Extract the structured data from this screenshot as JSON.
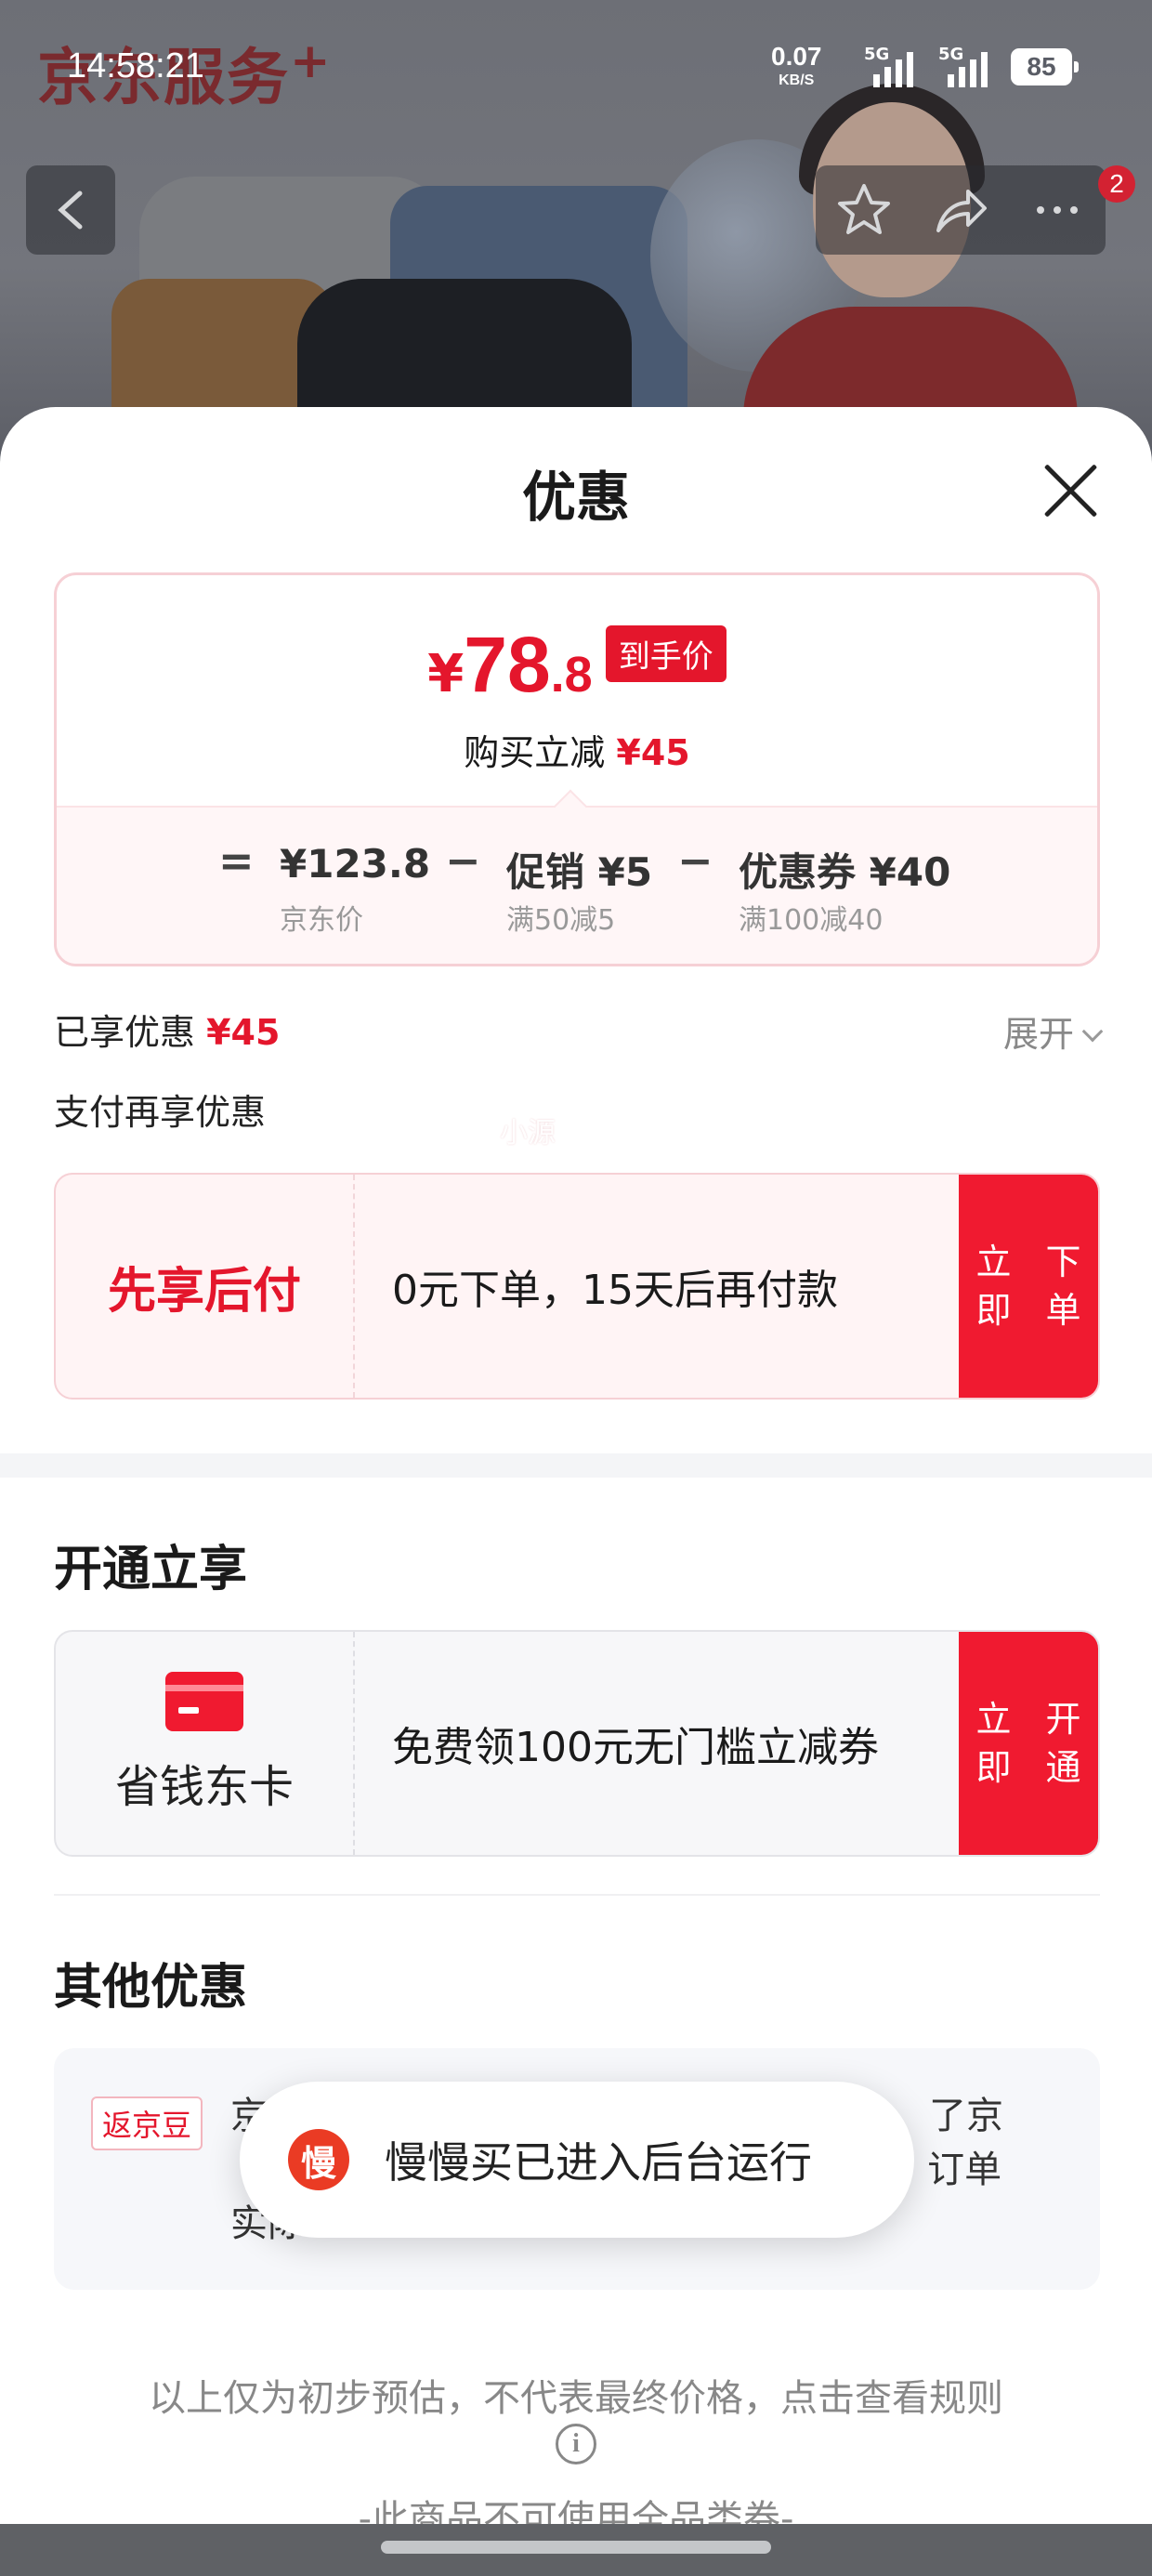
{
  "status_bar": {
    "time": "14:58:21",
    "net_speed": "0.07",
    "net_unit": "KB/S",
    "sim1": "5G",
    "sim2": "5G",
    "battery": "85"
  },
  "header": {
    "brand": "京东服务",
    "brand_plus": "+",
    "cart_badge": "2"
  },
  "sheet": {
    "title": "优惠",
    "price": {
      "currency": "¥",
      "final_int": "78",
      "final_dec": ".8",
      "final_tag": "到手价",
      "save_label": "购买立减",
      "save_amount": "¥45",
      "formula_eq": "=",
      "jd_price": "¥123.8",
      "jd_price_label": "京东价",
      "minus1": "−",
      "promo": "促销 ¥5",
      "promo_rule": "满50减5",
      "minus2": "−",
      "coupon": "优惠券 ¥40",
      "coupon_rule": "满100减40"
    },
    "enjoyed_label": "已享优惠",
    "enjoyed_amount": "¥45",
    "expand_label": "展开",
    "pay_section_label": "支付再享优惠",
    "pay_offer": {
      "title": "先享后付",
      "desc": "0元下单，15天后再付款",
      "button_line1": "立即",
      "button_line2": "下单",
      "watermark": "小源"
    },
    "open_section_title": "开通立享",
    "club_offer": {
      "label": "省钱东卡",
      "desc": "免费领100元无门槛立减券",
      "button_line1": "立即",
      "button_line2": "开通"
    },
    "other_section_title": "其他优惠",
    "other_offer": {
      "tag": "返京豆",
      "text_line1": "京                                                        了京",
      "text_line2": "                                                           订单",
      "text_line3": "实际"
    },
    "footnote": "以上仅为初步预估，不代表最终价格，点击查看规则",
    "footnote2": "-此商品不可使用全品类券-"
  },
  "toast": {
    "icon_char": "慢",
    "text": "慢慢买已进入后台运行"
  },
  "icons": [
    "back-icon",
    "star-icon",
    "share-icon",
    "more-icon",
    "close-icon",
    "chevron-down-icon",
    "card-icon",
    "info-icon",
    "app-icon"
  ]
}
